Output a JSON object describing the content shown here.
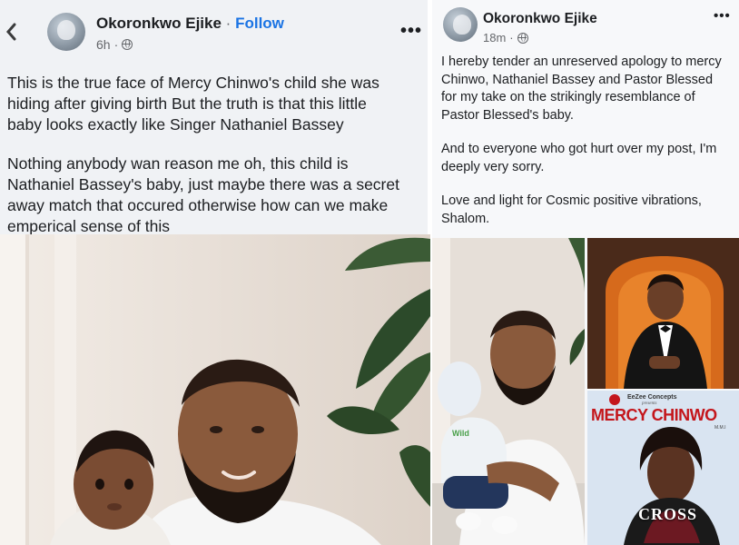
{
  "left_post": {
    "author": "Okoronkwo Ejike",
    "separator": "·",
    "follow_label": "Follow",
    "time": "6h",
    "more_icon": "more-horizontal-icon",
    "back_icon": "chevron-left-icon",
    "paragraph1": "This is the true face of Mercy Chinwo's child she was\nhiding after giving birth But the truth is that this little\nbaby looks exactly like Singer Nathaniel Bassey",
    "paragraph2": "Nothing anybody wan reason me oh, this child is\nNathaniel Bassey's baby, just maybe there was a secret\naway match that occured otherwise how can we make\nemperical sense of this"
  },
  "right_post": {
    "author": "Okoronkwo Ejike",
    "time": "18m",
    "more_icon": "more-horizontal-icon",
    "paragraph1": "I hereby tender an unreserved apology to mercy\nChinwo, Nathaniel Bassey and Pastor Blessed\nfor my take on the strikingly resemblance of\nPastor Blessed's baby.",
    "paragraph2": "And to everyone who got hurt over my post, I'm\ndeeply very sorry.",
    "paragraph3": "Love and light for Cosmic positive vibrations,\nShalom."
  },
  "album_cover": {
    "studio": "EeZee Concepts",
    "presents": "presents",
    "artist": "MERCY CHINWO",
    "suffix": "M.M.I",
    "title": "CROSS"
  },
  "colors": {
    "link_blue": "#1b74e4",
    "meta_grey": "#65676b",
    "album_red": "#c4161c"
  }
}
